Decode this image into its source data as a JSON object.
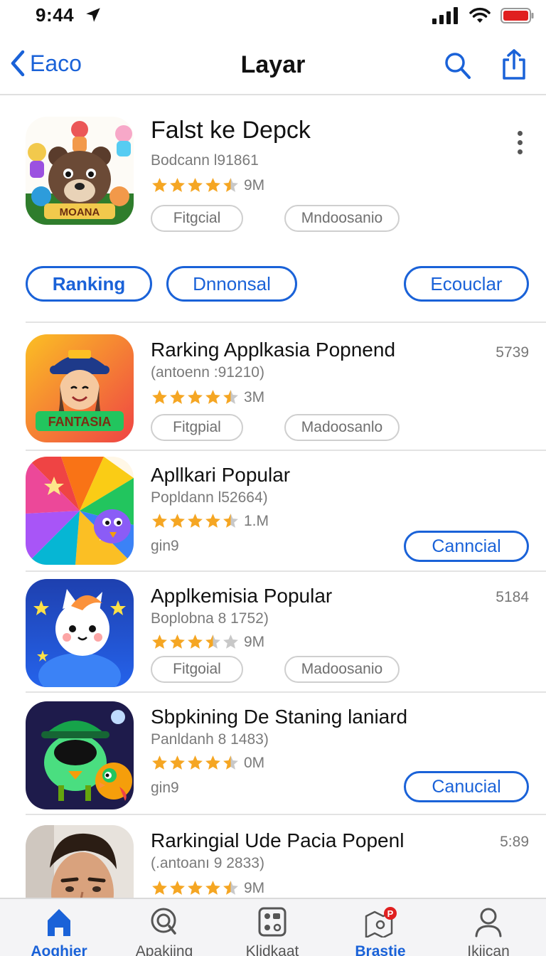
{
  "status_bar": {
    "time": "9:44"
  },
  "nav": {
    "back_label": "Eaco",
    "title": "Layar"
  },
  "hero": {
    "title": "Falst ke Depck",
    "subtitle": "Bodcann l91861",
    "rating": 4.5,
    "rating_count": "9M",
    "chips": [
      "Fitgcial",
      "Mndoosanio"
    ]
  },
  "filters": [
    "Ranking",
    "Dnnonsal",
    "Ecouclar"
  ],
  "apps": [
    {
      "title": "Rarking Applkasia Popnend",
      "subtitle": "(antoenn :91210)",
      "rank": "5739",
      "rating": 4.5,
      "rating_count": "3M",
      "chips": [
        "Fitgpial",
        "Madoosanlo"
      ],
      "icon": "fantasia-character-icon"
    },
    {
      "title": "Apllkari Popular",
      "subtitle": "Popldann l52664)",
      "rank": "",
      "rating": 4.5,
      "rating_count": "1.M",
      "note": "gin9",
      "button": "Canncial",
      "icon": "colorful-burst-icon"
    },
    {
      "title": "Applkemisia Popular",
      "subtitle": "Boplobna 8 1752)",
      "rank": "5184",
      "rating": 3.5,
      "rating_count": "9M",
      "chips": [
        "Fitgoial",
        "Madoosanio"
      ],
      "icon": "cute-cat-icon"
    },
    {
      "title": "Sbpkining De Staning laniard",
      "subtitle": "Panldanh 8 1483)",
      "rank": "",
      "rating": 4.5,
      "rating_count": "0M",
      "note": "gin9",
      "button": "Canucial",
      "icon": "green-bird-icon"
    },
    {
      "title": "Rarkingial Ude Pacia Popenl",
      "subtitle": "(.antoanı 9 2833)",
      "rank": "5:89",
      "rating": 4.5,
      "rating_count": "9M",
      "icon": "portrait-photo-icon"
    }
  ],
  "tabs": [
    {
      "label": "Aoghier",
      "icon": "home-icon",
      "active": true
    },
    {
      "label": "Apakiing",
      "icon": "search-icon",
      "active": false
    },
    {
      "label": "Klidkaat",
      "icon": "apps-icon",
      "active": false
    },
    {
      "label": "Brastie",
      "icon": "map-icon",
      "active": false
    },
    {
      "label": "Ikiican",
      "icon": "person-icon",
      "active": false
    }
  ],
  "colors": {
    "accent": "#1a62d8",
    "star": "#f5a623",
    "star_empty": "#c8c8c8",
    "battery": "#e02020"
  }
}
